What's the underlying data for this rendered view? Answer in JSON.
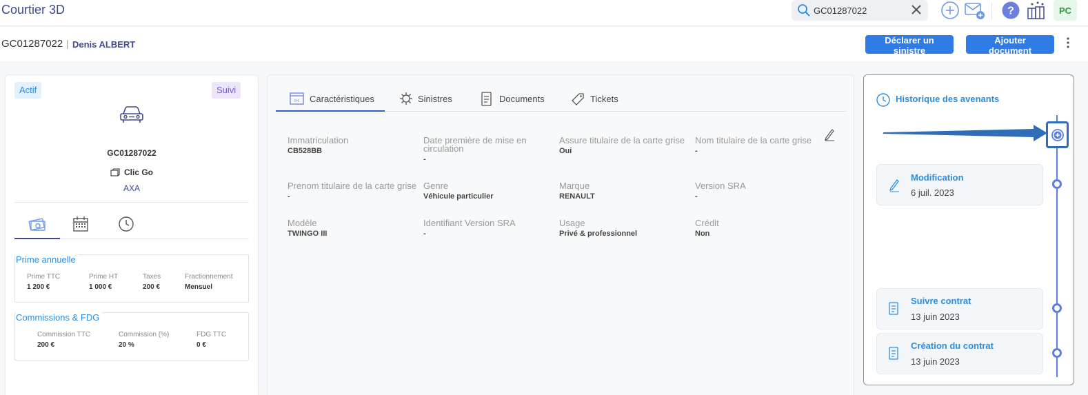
{
  "app": {
    "title": "Courtier 3D"
  },
  "search": {
    "value": "GC01287022"
  },
  "user": {
    "initials": "PC"
  },
  "header": {
    "contract_id": "GC01287022",
    "separator": "|",
    "client_name": "Denis ALBERT",
    "declare_button": "Déclarer un sinistre",
    "add_doc_button": "Ajouter document"
  },
  "summary": {
    "status_badge": "Actif",
    "follow_badge": "Suivi",
    "vehicle_id": "GC01287022",
    "product": "Clic Go",
    "insurer": "AXA",
    "prime": {
      "legend": "Prime annuelle",
      "items": [
        {
          "label": "Prime TTC",
          "value": "1 200 €"
        },
        {
          "label": "Prime HT",
          "value": "1 000 €"
        },
        {
          "label": "Taxes",
          "value": "200 €"
        },
        {
          "label": "Fractionnement",
          "value": "Mensuel"
        }
      ]
    },
    "commissions": {
      "legend": "Commissions & FDG",
      "items": [
        {
          "label": "Commission TTC",
          "value": "200 €"
        },
        {
          "label": "Commission (%)",
          "value": "20 %"
        },
        {
          "label": "FDG TTC",
          "value": "0 €"
        }
      ]
    }
  },
  "tabs": [
    {
      "label": "Caractéristiques",
      "active": true
    },
    {
      "label": "Sinistres"
    },
    {
      "label": "Documents"
    },
    {
      "label": "Tickets"
    }
  ],
  "fields": [
    {
      "label": "Immatriculation",
      "value": "CB528BB"
    },
    {
      "label": "Date première de mise en circulation",
      "value": "-"
    },
    {
      "label": "Assure titulaire de la carte grise",
      "value": "Oui"
    },
    {
      "label": "Nom titulaire de la carte grise",
      "value": "-"
    },
    {
      "label": "Prenom titulaire de la carte grise",
      "value": "-"
    },
    {
      "label": "Genre",
      "value": "Véhicule particulier"
    },
    {
      "label": "Marque",
      "value": "RENAULT"
    },
    {
      "label": "Version SRA",
      "value": "-"
    },
    {
      "label": "Modèle",
      "value": "TWINGO III"
    },
    {
      "label": "Identifiant Version SRA",
      "value": "-"
    },
    {
      "label": "Usage",
      "value": "Privé & professionnel"
    },
    {
      "label": "Crédit",
      "value": "Non"
    }
  ],
  "history": {
    "title": "Historique des avenants",
    "events": [
      {
        "title": "Modification",
        "date": "6 juil. 2023",
        "icon": "pencil-icon"
      },
      {
        "title": "Suivre contrat",
        "date": "13 juin 2023",
        "icon": "document-icon"
      },
      {
        "title": "Création du contrat",
        "date": "13 juin 2023",
        "icon": "document-icon"
      }
    ]
  },
  "colors": {
    "primary_button": "#2f7ce6",
    "accent_blue": "#2a8de0",
    "timeline": "#5a7fe0"
  }
}
